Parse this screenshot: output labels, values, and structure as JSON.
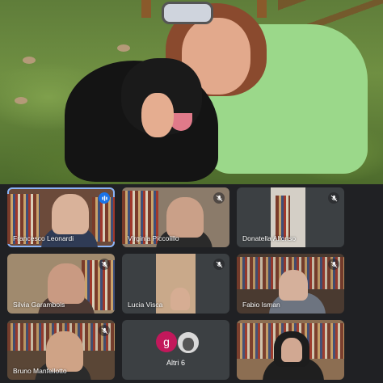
{
  "participants": [
    {
      "name": "Francesco Leonardi",
      "speaking": true
    },
    {
      "name": "Virginia Piccolillo",
      "muted": true
    },
    {
      "name": "Donatella Alfonso",
      "muted": true
    },
    {
      "name": "Silvia Garambois",
      "muted": true
    },
    {
      "name": "Lucia Visca",
      "muted": true
    },
    {
      "name": "Fabio Isman",
      "muted": true
    },
    {
      "name": "Bruno Manfellotto",
      "muted": true
    },
    {
      "name": "Altri 6"
    },
    {
      "name": ""
    }
  ],
  "others_tile": {
    "label": "Altri 6",
    "avatar_letter": "g",
    "avatar_color": "#c2185b"
  },
  "colors": {
    "background": "#202124",
    "tile": "#3c4043",
    "active_outline": "#8ab4f8",
    "speaking": "#1a73e8"
  },
  "icons": {
    "muted": "mic-off-icon",
    "speaking": "audio-level-icon"
  }
}
